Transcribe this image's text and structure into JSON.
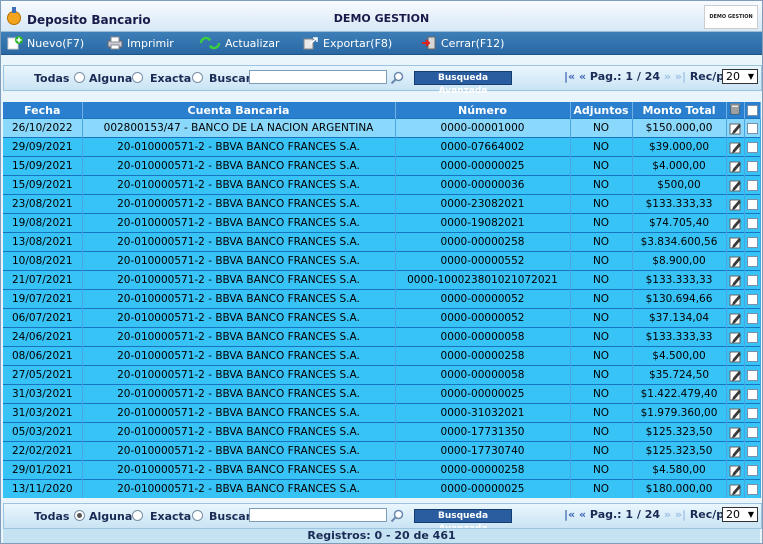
{
  "app": {
    "title": "Deposito Bancario",
    "company": "DEMO GESTION",
    "badge": "DEMO GESTION"
  },
  "toolbar": {
    "nuevo": "Nuevo(F7)",
    "imprimir": "Imprimir",
    "actualizar": "Actualizar",
    "exportar": "Exportar(F8)",
    "cerrar": "Cerrar(F12)"
  },
  "search_top": {
    "todas": "Todas",
    "alguna": "Alguna",
    "exacta": "Exacta",
    "buscar": "Buscar",
    "selected": "none",
    "value": "",
    "advanced": "Busqueda Avanzada",
    "pager_prefix": "«  « Pag.:",
    "page": "1 / 24",
    "pager_suffix": "» »|",
    "rec_label": "Rec/pg:",
    "rec_value": "20"
  },
  "search_bottom": {
    "todas": "Todas",
    "alguna": "Alguna",
    "exacta": "Exacta",
    "buscar": "Buscar",
    "selected": "todas",
    "value": "",
    "advanced": "Busqueda Avanzada",
    "pager_prefix": "|«  « Pag.:",
    "page": "1 / 24",
    "pager_suffix": "» »|",
    "rec_label": "Rec/pg:",
    "rec_value": "20"
  },
  "table": {
    "headers": {
      "fecha": "Fecha",
      "cuenta": "Cuenta Bancaria",
      "numero": "Número",
      "adjuntos": "Adjuntos",
      "monto": "Monto Total"
    },
    "rows": [
      {
        "fecha": "26/10/2022",
        "cuenta": "002800153/47 - BANCO DE LA NACION ARGENTINA",
        "numero": "0000-00001000",
        "adjuntos": "NO",
        "monto": "$150.000,00"
      },
      {
        "fecha": "29/09/2021",
        "cuenta": "20-010000571-2 - BBVA BANCO FRANCES S.A.",
        "numero": "0000-07664002",
        "adjuntos": "NO",
        "monto": "$39.000,00"
      },
      {
        "fecha": "15/09/2021",
        "cuenta": "20-010000571-2 - BBVA BANCO FRANCES S.A.",
        "numero": "0000-00000025",
        "adjuntos": "NO",
        "monto": "$4.000,00"
      },
      {
        "fecha": "15/09/2021",
        "cuenta": "20-010000571-2 - BBVA BANCO FRANCES S.A.",
        "numero": "0000-00000036",
        "adjuntos": "NO",
        "monto": "$500,00"
      },
      {
        "fecha": "23/08/2021",
        "cuenta": "20-010000571-2 - BBVA BANCO FRANCES S.A.",
        "numero": "0000-23082021",
        "adjuntos": "NO",
        "monto": "$133.333,33"
      },
      {
        "fecha": "19/08/2021",
        "cuenta": "20-010000571-2 - BBVA BANCO FRANCES S.A.",
        "numero": "0000-19082021",
        "adjuntos": "NO",
        "monto": "$74.705,40"
      },
      {
        "fecha": "13/08/2021",
        "cuenta": "20-010000571-2 - BBVA BANCO FRANCES S.A.",
        "numero": "0000-00000258",
        "adjuntos": "NO",
        "monto": "$3.834.600,56"
      },
      {
        "fecha": "10/08/2021",
        "cuenta": "20-010000571-2 - BBVA BANCO FRANCES S.A.",
        "numero": "0000-00000552",
        "adjuntos": "NO",
        "monto": "$8.900,00"
      },
      {
        "fecha": "21/07/2021",
        "cuenta": "20-010000571-2 - BBVA BANCO FRANCES S.A.",
        "numero": "0000-100023801021072021",
        "adjuntos": "NO",
        "monto": "$133.333,33"
      },
      {
        "fecha": "19/07/2021",
        "cuenta": "20-010000571-2 - BBVA BANCO FRANCES S.A.",
        "numero": "0000-00000052",
        "adjuntos": "NO",
        "monto": "$130.694,66"
      },
      {
        "fecha": "06/07/2021",
        "cuenta": "20-010000571-2 - BBVA BANCO FRANCES S.A.",
        "numero": "0000-00000052",
        "adjuntos": "NO",
        "monto": "$37.134,04"
      },
      {
        "fecha": "24/06/2021",
        "cuenta": "20-010000571-2 - BBVA BANCO FRANCES S.A.",
        "numero": "0000-00000058",
        "adjuntos": "NO",
        "monto": "$133.333,33"
      },
      {
        "fecha": "08/06/2021",
        "cuenta": "20-010000571-2 - BBVA BANCO FRANCES S.A.",
        "numero": "0000-00000258",
        "adjuntos": "NO",
        "monto": "$4.500,00"
      },
      {
        "fecha": "27/05/2021",
        "cuenta": "20-010000571-2 - BBVA BANCO FRANCES S.A.",
        "numero": "0000-00000058",
        "adjuntos": "NO",
        "monto": "$35.724,50"
      },
      {
        "fecha": "31/03/2021",
        "cuenta": "20-010000571-2 - BBVA BANCO FRANCES S.A.",
        "numero": "0000-00000025",
        "adjuntos": "NO",
        "monto": "$1.422.479,40"
      },
      {
        "fecha": "31/03/2021",
        "cuenta": "20-010000571-2 - BBVA BANCO FRANCES S.A.",
        "numero": "0000-31032021",
        "adjuntos": "NO",
        "monto": "$1.979.360,00"
      },
      {
        "fecha": "05/03/2021",
        "cuenta": "20-010000571-2 - BBVA BANCO FRANCES S.A.",
        "numero": "0000-17731350",
        "adjuntos": "NO",
        "monto": "$125.323,50"
      },
      {
        "fecha": "22/02/2021",
        "cuenta": "20-010000571-2 - BBVA BANCO FRANCES S.A.",
        "numero": "0000-17730740",
        "adjuntos": "NO",
        "monto": "$125.323,50"
      },
      {
        "fecha": "29/01/2021",
        "cuenta": "20-010000571-2 - BBVA BANCO FRANCES S.A.",
        "numero": "0000-00000258",
        "adjuntos": "NO",
        "monto": "$4.580,00"
      },
      {
        "fecha": "13/11/2020",
        "cuenta": "20-010000571-2 - BBVA BANCO FRANCES S.A.",
        "numero": "0000-00000025",
        "adjuntos": "NO",
        "monto": "$180.000,00"
      }
    ]
  },
  "status": {
    "text": "Registros: 0 - 20 de 461"
  },
  "colors": {
    "header": "#2a7fcf",
    "row": "#38c3f7",
    "row_highlight": "#8ad8fb",
    "toolbar": "#2a68a3"
  },
  "icons": {
    "nuevo": "plus-icon",
    "imprimir": "printer-icon",
    "actualizar": "refresh-icon",
    "exportar": "export-icon",
    "cerrar": "exit-door-icon",
    "edit": "edit-icon",
    "delete_header": "trash-icon"
  }
}
